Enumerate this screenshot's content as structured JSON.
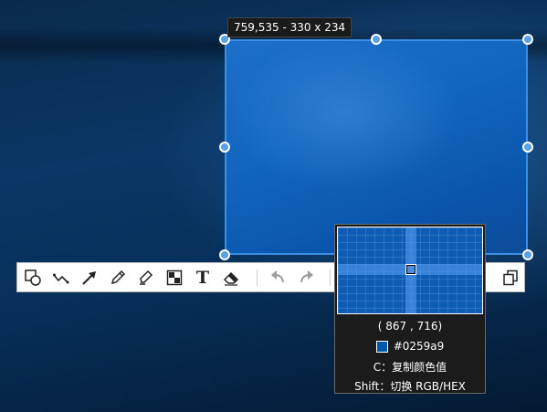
{
  "selection": {
    "info_label": "759,535 - 330 x 234",
    "accent_color": "#3a8ee6"
  },
  "toolbar": {
    "tools": [
      {
        "icon": "shape-rect-circle-icon"
      },
      {
        "icon": "polyline-icon"
      },
      {
        "icon": "arrow-icon"
      },
      {
        "icon": "pencil-icon"
      },
      {
        "icon": "highlighter-icon"
      },
      {
        "icon": "mosaic-icon"
      },
      {
        "icon": "text-icon",
        "glyph": "T"
      },
      {
        "icon": "eraser-icon"
      },
      {
        "icon": "undo-icon"
      },
      {
        "icon": "redo-icon"
      },
      {
        "icon": "copy-icon"
      }
    ]
  },
  "magnifier": {
    "coords": "( 867 ,  716)",
    "hex": "#0259a9",
    "swatch_color": "#0259a9",
    "hint_copy": "C：复制颜色值",
    "hint_switch": "Shift：切换 RGB/HEX"
  }
}
